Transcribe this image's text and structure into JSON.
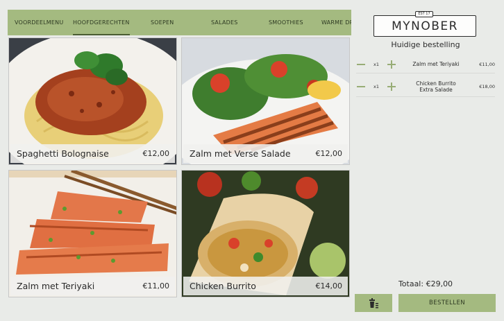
{
  "tabs": [
    {
      "label": "VOORDEELMENU"
    },
    {
      "label": "HOOFDGERECHTEN"
    },
    {
      "label": "SOEPEN"
    },
    {
      "label": "SALADES"
    },
    {
      "label": "SMOOTHIES"
    },
    {
      "label": "WARME DR"
    }
  ],
  "products": [
    {
      "name": "Spaghetti Bolognaise",
      "price": "€12,00"
    },
    {
      "name": "Zalm met Verse Salade",
      "price": "€12,00"
    },
    {
      "name": "Zalm met Teriyaki",
      "price": "€11,00"
    },
    {
      "name": "Chicken Burrito",
      "price": "€14,00"
    }
  ],
  "sidebar": {
    "logo_badge": "EST 17",
    "logo_text": "MYNOBER",
    "order_title": "Huidige bestelling",
    "items": [
      {
        "qty": "x1",
        "name": "Zalm met Teriyaki",
        "price": "€11,00"
      },
      {
        "qty": "x1",
        "name": "Chicken Burrito\nExtra Salade",
        "price": "€18,00"
      }
    ],
    "total": "Totaal: €29,00",
    "order_button": "BESTELLEN"
  },
  "colors": {
    "accent": "#a4ba80",
    "background": "#e9ebe8"
  }
}
